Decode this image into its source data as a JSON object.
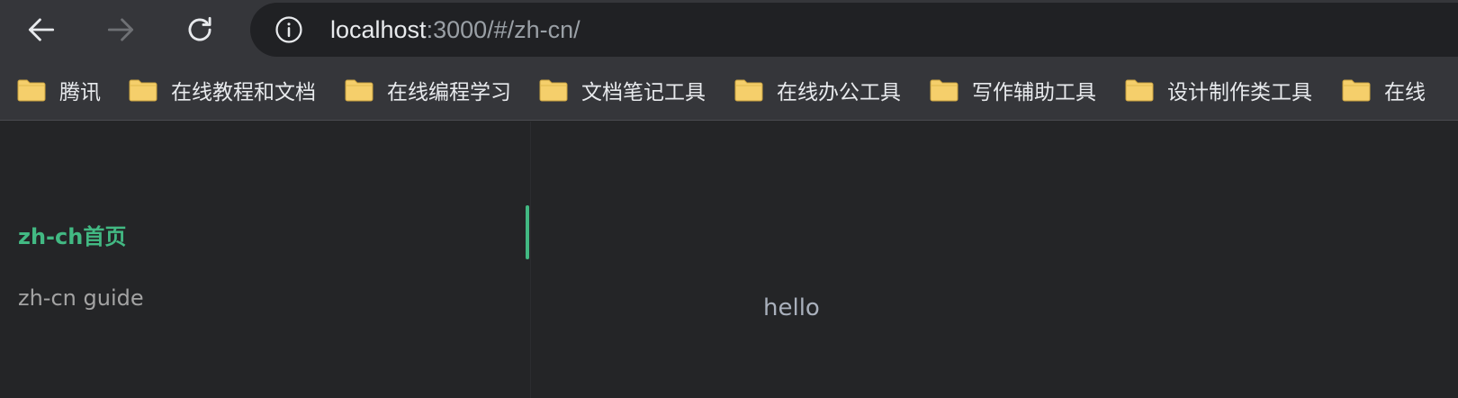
{
  "browser": {
    "url_host": "localhost",
    "url_rest": ":3000/#/zh-cn/"
  },
  "bookmarks": [
    {
      "label": "腾讯"
    },
    {
      "label": "在线教程和文档"
    },
    {
      "label": "在线编程学习"
    },
    {
      "label": "文档笔记工具"
    },
    {
      "label": "在线办公工具"
    },
    {
      "label": "写作辅助工具"
    },
    {
      "label": "设计制作类工具"
    },
    {
      "label": "在线"
    }
  ],
  "sidebar": {
    "items": [
      {
        "label": "zh-ch首页",
        "active": true
      },
      {
        "label": "zh-cn guide",
        "active": false
      }
    ]
  },
  "main": {
    "text": "hello"
  },
  "colors": {
    "accent": "#42b983",
    "folder": "#f5cf6b"
  }
}
